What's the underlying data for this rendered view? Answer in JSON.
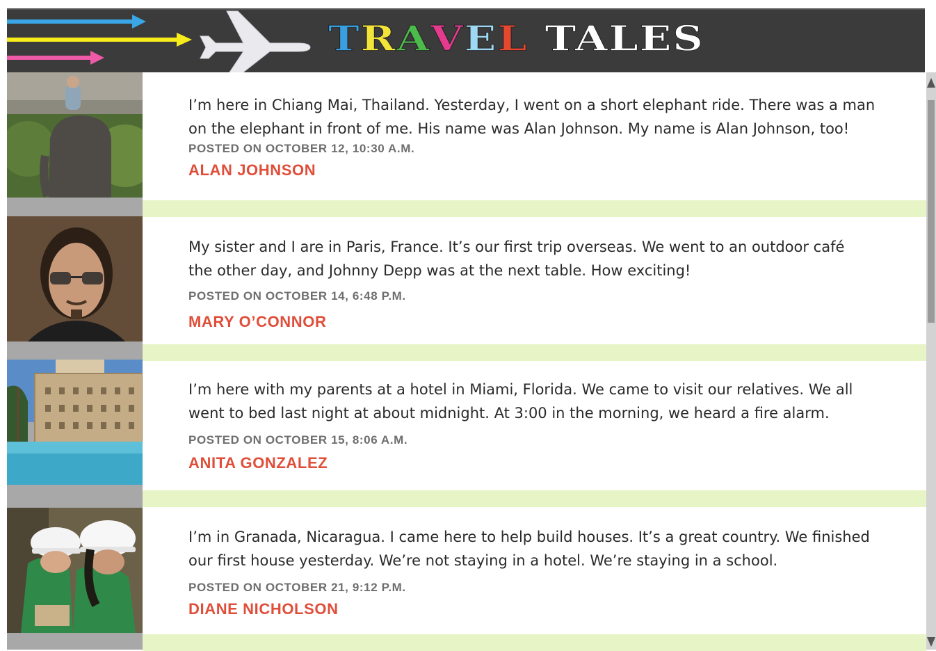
{
  "header": {
    "title_word1": [
      "T",
      "R",
      "A",
      "V",
      "E",
      "L"
    ],
    "title_word1_colors": [
      "#3a9fe0",
      "#f3e43a",
      "#4cbb4c",
      "#e63a8f",
      "#9fd8f2",
      "#e6472f"
    ],
    "title_word2": "TALES",
    "title_word2_color": "#ffffff",
    "arrow_colors": [
      "#3aa6e6",
      "#f6ec1c",
      "#ef5aa8"
    ],
    "plane_icon": "airplane-icon"
  },
  "posts": [
    {
      "text_line1": "I’m here in Chiang Mai, Thailand. Yesterday, I went on a short elephant ride. There was a man",
      "text_line2": "on the elephant in front of me. His name was Alan Johnson. My name is Alan Johnson, too!",
      "posted": "POSTED ON OCTOBER 12, 10:30 A.M.",
      "author": "ALAN JOHNSON"
    },
    {
      "text_line1": "My sister and I are in Paris, France. It’s our first trip overseas. We went to an outdoor café",
      "text_line2": "the other day, and Johnny Depp was at the next table. How exciting!",
      "posted": "POSTED ON OCTOBER 14, 6:48 P.M.",
      "author": "MARY O’CONNOR"
    },
    {
      "text_line1": "I’m here with my parents at a hotel in Miami, Florida. We came to visit our relatives. We all",
      "text_line2": "went to bed last night at about midnight.  At 3:00 in the morning, we heard a fire alarm.",
      "posted": "POSTED ON OCTOBER 15, 8:06 A.M.",
      "author": "ANITA GONZALEZ"
    },
    {
      "text_line1": "I’m in Granada, Nicaragua. I came here to help build houses. It’s a great country. We finished",
      "text_line2": "our first house yesterday. We’re not staying in a hotel.  We’re staying in a school.",
      "posted": "POSTED ON OCTOBER 21, 9:12 P.M.",
      "author": "DIANE NICHOLSON"
    }
  ],
  "colors": {
    "separator": "#e6f4c6",
    "author": "#e04e3a",
    "meta": "#6e6e6e",
    "header_bg": "#3b3b3b"
  }
}
